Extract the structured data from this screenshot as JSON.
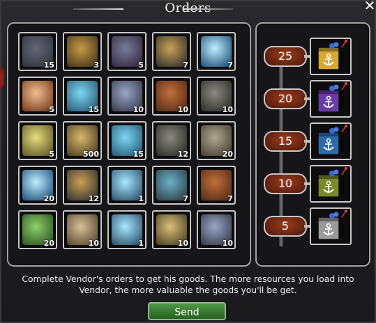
{
  "window": {
    "title": "Orders",
    "close_icon": "close-x-icon"
  },
  "orders": [
    {
      "icon": "soldier-portrait-icon",
      "qty": "15",
      "c1": "#667",
      "c2": "#2b2f36"
    },
    {
      "icon": "brass-mechanism-icon",
      "qty": "3",
      "c1": "#c59a44",
      "c2": "#3a2a14"
    },
    {
      "icon": "steel-sphere-icon",
      "qty": "5",
      "c1": "#7b7b9a",
      "c2": "#2a2036"
    },
    {
      "icon": "compass-icon",
      "qty": "7",
      "c1": "#c9a255",
      "c2": "#22252b"
    },
    {
      "icon": "blue-energy-orb-icon",
      "qty": "7",
      "c1": "#bfefff",
      "c2": "#0b3f6a"
    },
    {
      "icon": "crystal-ball-icon",
      "qty": "5",
      "c1": "#f0c090",
      "c2": "#6a2b10"
    },
    {
      "icon": "blue-capsule-icon",
      "qty": "15",
      "c1": "#7fd6f2",
      "c2": "#1a4c6a"
    },
    {
      "icon": "rocket-engine-icon",
      "qty": "10",
      "c1": "#9aa6c6",
      "c2": "#2a2f3d"
    },
    {
      "icon": "leather-book-icon",
      "qty": "10",
      "c1": "#c0703a",
      "c2": "#4a2410"
    },
    {
      "icon": "werewolf-portrait-icon",
      "qty": "10",
      "c1": "#8a8a80",
      "c2": "#222220"
    },
    {
      "icon": "fuel-canister-icon",
      "qty": "5",
      "c1": "#e6de7a",
      "c2": "#4f4a20"
    },
    {
      "icon": "brass-shell-icon",
      "qty": "500",
      "c1": "#d8b868",
      "c2": "#3d321a"
    },
    {
      "icon": "blue-capsule-icon",
      "qty": "15",
      "c1": "#7fd6f2",
      "c2": "#1a4c6a"
    },
    {
      "icon": "werewolf-portrait-icon",
      "qty": "12",
      "c1": "#8a8a80",
      "c2": "#222220"
    },
    {
      "icon": "soldier-portrait-icon",
      "qty": "20",
      "c1": "#b0a890",
      "c2": "#3a3428"
    },
    {
      "icon": "blue-energy-orb-icon",
      "qty": "20",
      "c1": "#bfefff",
      "c2": "#0b3f6a"
    },
    {
      "icon": "compass-icon",
      "qty": "12",
      "c1": "#c9a255",
      "c2": "#22252b"
    },
    {
      "icon": "tesla-coil-icon",
      "qty": "1",
      "c1": "#a9e8ff",
      "c2": "#1b3f5c"
    },
    {
      "icon": "brass-telescope-icon",
      "qty": "7",
      "c1": "#6ab0c8",
      "c2": "#2a3438"
    },
    {
      "icon": "leather-book-icon",
      "qty": "7",
      "c1": "#c0703a",
      "c2": "#4a2410"
    },
    {
      "icon": "missile-icon",
      "qty": "20",
      "c1": "#8fcf6a",
      "c2": "#23471a"
    },
    {
      "icon": "treasure-map-icon",
      "qty": "10",
      "c1": "#d8c098",
      "c2": "#4a3a24"
    },
    {
      "icon": "tesla-coil-icon",
      "qty": "1",
      "c1": "#a9e8ff",
      "c2": "#1b3f5c"
    },
    {
      "icon": "ammo-shells-icon",
      "qty": "10",
      "c1": "#d8c07a",
      "c2": "#3d321a"
    },
    {
      "icon": "rocket-engine-icon",
      "qty": "10",
      "c1": "#9aa6c6",
      "c2": "#2a2f3d"
    }
  ],
  "tiers": [
    {
      "value": "25",
      "crate_icon": "gold-anchor-crate-icon",
      "color": "#d9a830"
    },
    {
      "value": "20",
      "crate_icon": "purple-anchor-crate-icon",
      "color": "#6a3aa8"
    },
    {
      "value": "15",
      "crate_icon": "blue-anchor-crate-icon",
      "color": "#2d6aa8"
    },
    {
      "value": "10",
      "crate_icon": "olive-anchor-crate-icon",
      "color": "#7a8a2a"
    },
    {
      "value": "5",
      "crate_icon": "silver-anchor-crate-icon",
      "color": "#9a9a9a"
    }
  ],
  "description": "Complete Vendor's orders to get his goods. The more resources you load into Vendor, the more valuable the goods you'll be get.",
  "send_label": "Send"
}
